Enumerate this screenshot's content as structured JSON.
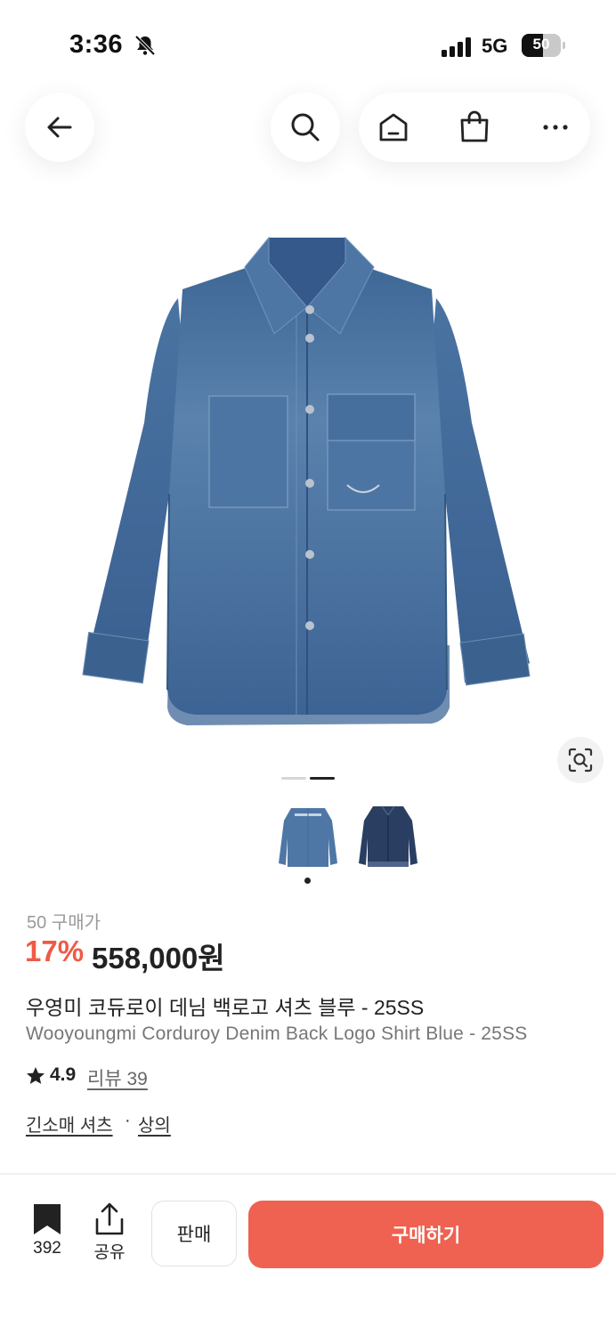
{
  "status_bar": {
    "time": "3:36",
    "network": "5G",
    "battery": "50"
  },
  "nav": {
    "back_icon": "arrow-left-icon",
    "search_icon": "search-icon",
    "home_icon": "home-icon",
    "bag_icon": "shopping-bag-icon",
    "more_icon": "more-horizontal-icon"
  },
  "gallery": {
    "image": "denim-shirt-front",
    "slide_index": 2,
    "slide_count": 2
  },
  "product": {
    "purchase_count": "50 구매가",
    "discount": "17%",
    "price": "558,000원",
    "name_ko": "우영미 코듀로이 데님 백로고 셔츠 블루 - 25SS",
    "name_en": "Wooyoungmi Corduroy Denim Back Logo Shirt Blue - 25SS",
    "rating": "4.9",
    "review": "리뷰 39",
    "category_1": "긴소매 셔츠",
    "separator": "·",
    "category_2": "상의"
  },
  "bottom_bar": {
    "bookmark_count": "392",
    "share_label": "공유",
    "sell_label": "판매",
    "buy_label": "구매하기"
  },
  "colors": {
    "accent": "#ef5a45",
    "buy_button": "#ef6150",
    "denim": "#3e6494"
  }
}
